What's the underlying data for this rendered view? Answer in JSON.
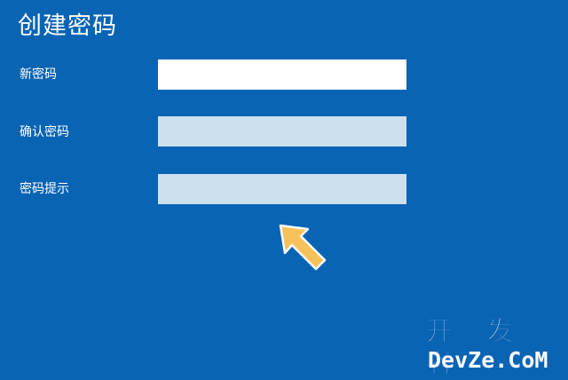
{
  "page": {
    "title": "创建密码",
    "background_color": "#0a64b4"
  },
  "form": {
    "new_password_label": "新密码",
    "confirm_password_label": "确认密码",
    "hint_label": "密码提示",
    "new_password_value": "",
    "confirm_password_value": "",
    "hint_value": ""
  },
  "annotation": {
    "pointer": "arrow-pointer-icon",
    "pointer_color": "#f7c15c"
  },
  "watermark": {
    "line1": "开 发 者",
    "line2": "DevZe.CoM"
  }
}
